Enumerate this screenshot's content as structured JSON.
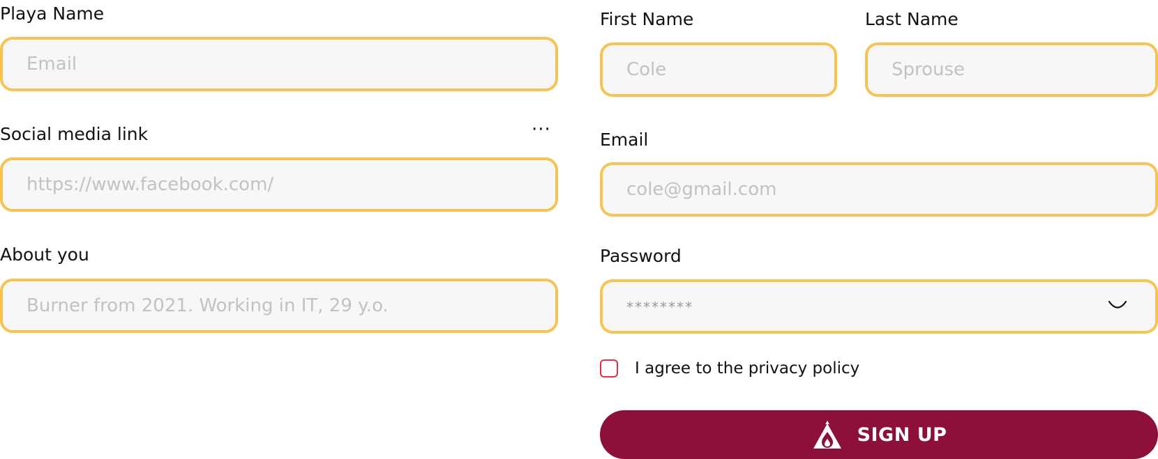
{
  "left_form": {
    "playa_name": {
      "label": "Playa Name",
      "placeholder": "Email",
      "value": ""
    },
    "social_link": {
      "label": "Social media link",
      "placeholder": "https://www.facebook.com/",
      "value": "",
      "more_label": "···"
    },
    "about": {
      "label": "About you",
      "placeholder": "Burner from 2021. Working in IT, 29 y.o.",
      "value": ""
    }
  },
  "right_form": {
    "first_name": {
      "label": "First Name",
      "placeholder": "Cole",
      "value": ""
    },
    "last_name": {
      "label": "Last Name",
      "placeholder": "Sprouse",
      "value": ""
    },
    "email": {
      "label": "Email",
      "placeholder": "cole@gmail.com",
      "value": ""
    },
    "password": {
      "label": "Password",
      "placeholder": "********",
      "value": "",
      "toggle_icon": "eye-closed-icon"
    },
    "privacy": {
      "label": "I agree to the privacy policy",
      "checked": false
    },
    "submit": {
      "label": "SIGN UP",
      "icon": "tent-fire-icon"
    }
  },
  "colors": {
    "field_border": "#f6c452",
    "field_bg": "#f7f7f7",
    "primary": "#8c0f3c",
    "checkbox_border": "#d9304a"
  }
}
